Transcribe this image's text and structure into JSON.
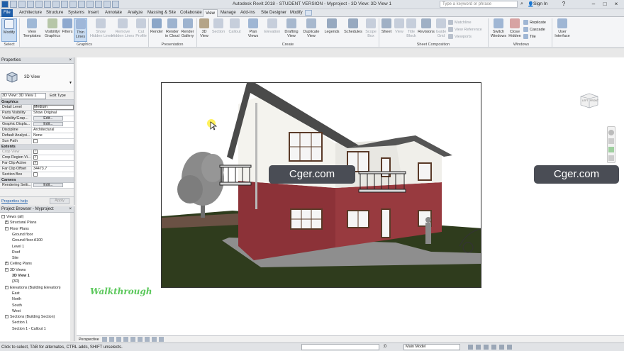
{
  "app": {
    "title": "Autodesk Revit 2018 - STUDENT VERSION -   Myproject - 3D View: 3D View 1",
    "search_placeholder": "Type a keyword or phrase",
    "sign_in": "Sign In",
    "help": "?",
    "minimize": "–",
    "maximize": "□",
    "close": "×"
  },
  "tabs": [
    {
      "label": "File",
      "id": "file"
    },
    {
      "label": "Architecture",
      "id": "architecture"
    },
    {
      "label": "Structure",
      "id": "structure"
    },
    {
      "label": "Systems",
      "id": "systems"
    },
    {
      "label": "Insert",
      "id": "insert"
    },
    {
      "label": "Annotate",
      "id": "annotate"
    },
    {
      "label": "Analyze",
      "id": "analyze"
    },
    {
      "label": "Massing & Site",
      "id": "massing"
    },
    {
      "label": "Collaborate",
      "id": "collaborate"
    },
    {
      "label": "View",
      "id": "view",
      "active": true
    },
    {
      "label": "Manage",
      "id": "manage"
    },
    {
      "label": "Add-Ins",
      "id": "addins"
    },
    {
      "label": "Site Designer",
      "id": "sitedesigner"
    },
    {
      "label": "Modify",
      "id": "modify"
    }
  ],
  "ribbon": {
    "modify": "Modify",
    "view_templates": "View\nTemplates",
    "visibility_graphics": "Visibility/\nGraphics",
    "filters": "Filters",
    "thin_lines": "Thin\nLines",
    "show_hidden_lines": "Show\nHidden Lines",
    "remove_hidden_lines": "Remove\nHidden Lines",
    "cut_profile": "Cut\nProfile",
    "render": "Render",
    "render_in_cloud": "Render\nin Cloud",
    "render_gallery": "Render\nGallery",
    "view_3d": "3D\nView",
    "section": "Section",
    "callout": "Callout",
    "plan_views": "Plan\nViews",
    "elevation": "Elevation",
    "drafting_view": "Drafting\nView",
    "duplicate_view": "Duplicate\nView",
    "legends": "Legends",
    "schedules": "Schedules",
    "scope_box": "Scope\nBox",
    "sheet": "Sheet",
    "view": "View",
    "title_block": "Title\nBlock",
    "revisions": "Revisions",
    "guide_grid": "Guide\nGrid",
    "matchline": "Matchline",
    "view_reference": "View Reference",
    "viewports": "Viewports",
    "switch_windows": "Switch\nWindows",
    "close_hidden": "Close\nHidden",
    "replicate": "Replicate",
    "cascade": "Cascade",
    "tile": "Tile",
    "user_interface": "User\nInterface",
    "panels": {
      "select": "Select",
      "graphics": "Graphics",
      "presentation": "Presentation",
      "create": "Create",
      "sheet_composition": "Sheet Composition",
      "windows": "Windows"
    }
  },
  "properties": {
    "title": "Properties",
    "close": "×",
    "type_name": "3D View",
    "instance": "3D View: 3D View 1",
    "edit_type": "Edit Type",
    "groups": [
      {
        "name": "Graphics",
        "rows": [
          {
            "k": "Detail Level",
            "v": "Medium",
            "box": true
          },
          {
            "k": "Parts Visibility",
            "v": "Show Original"
          },
          {
            "k": "Visibility/Grap...",
            "v": "Edit...",
            "btn": true
          },
          {
            "k": "Graphic Displa...",
            "v": "Edit...",
            "btn": true
          },
          {
            "k": "Discipline",
            "v": "Architectural"
          },
          {
            "k": "Default Analysi...",
            "v": "None"
          },
          {
            "k": "Sun Path",
            "cb": false
          }
        ]
      },
      {
        "name": "Extents",
        "rows": [
          {
            "k": "Crop View",
            "cb": true,
            "dis": true
          },
          {
            "k": "Crop Region Vi...",
            "cb": true
          },
          {
            "k": "Far Clip Active",
            "cb": true
          },
          {
            "k": "Far Clip Offset",
            "v": "34473.7"
          },
          {
            "k": "Section Box",
            "cb": false
          }
        ]
      },
      {
        "name": "Camera",
        "rows": [
          {
            "k": "Rendering Setti...",
            "v": "Edit...",
            "btn": true
          }
        ]
      }
    ],
    "help_link": "Properties help",
    "apply": "Apply"
  },
  "browser": {
    "title": "Project Browser - Myproject",
    "close": "×",
    "items": [
      {
        "label": "Views (all)",
        "level": 0,
        "box": "−"
      },
      {
        "label": "Structural Plans",
        "level": 1,
        "box": "+"
      },
      {
        "label": "Floor Plans",
        "level": 1,
        "box": "−"
      },
      {
        "label": "Ground floor",
        "level": 3
      },
      {
        "label": "Ground floor A100",
        "level": 3
      },
      {
        "label": "Level 1",
        "level": 3
      },
      {
        "label": "Roof",
        "level": 3
      },
      {
        "label": "Site",
        "level": 3
      },
      {
        "label": "Ceiling Plans",
        "level": 1,
        "box": "+"
      },
      {
        "label": "3D Views",
        "level": 1,
        "box": "−"
      },
      {
        "label": "3D View 1",
        "level": 3,
        "bold": true
      },
      {
        "label": "{3D}",
        "level": 3
      },
      {
        "label": "Elevations (Building Elevation)",
        "level": 1,
        "box": "−"
      },
      {
        "label": "East",
        "level": 3
      },
      {
        "label": "North",
        "level": 3
      },
      {
        "label": "South",
        "level": 3
      },
      {
        "label": "West",
        "level": 3
      },
      {
        "label": "Sections (Building Section)",
        "level": 1,
        "box": "−"
      },
      {
        "label": "Section 1",
        "level": 3
      },
      {
        "label": "Section 1 - Callout 1",
        "level": 3
      }
    ]
  },
  "viewcube": {
    "left": "LEFT",
    "front": "FRONT"
  },
  "canvas": {
    "watermark_1": "Cger.com",
    "watermark_2": "Cger.com",
    "overlay_text": "Walkthrough"
  },
  "view_control": {
    "projection": "Perspective"
  },
  "status": {
    "message": "Click to select, TAB for alternates, CTRL adds, SHIFT unselects.",
    "model": "Main Model",
    "zero": ":0"
  },
  "colors": {
    "accent": "#1f5ea8",
    "wall_red": "#8c3238",
    "wall_white": "#f4f3ee",
    "grass": "#2f3c1d",
    "watermark_bg": "#4a4d55",
    "walkthrough": "#5cc85c"
  }
}
